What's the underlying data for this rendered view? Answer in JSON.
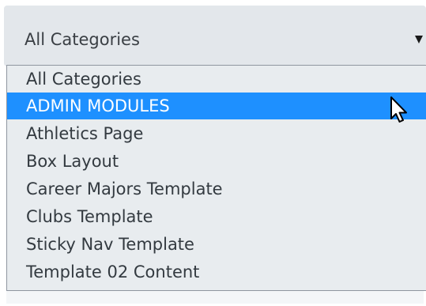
{
  "select": {
    "value": "All Categories",
    "arrow_icon": "triangle-down-icon"
  },
  "dropdown": {
    "options": [
      {
        "label": "All Categories",
        "selected": false
      },
      {
        "label": "ADMIN MODULES",
        "selected": true
      },
      {
        "label": "Athletics Page",
        "selected": false
      },
      {
        "label": "Box Layout",
        "selected": false
      },
      {
        "label": "Career Majors Template",
        "selected": false
      },
      {
        "label": "Clubs Template",
        "selected": false
      },
      {
        "label": "Sticky Nav Template",
        "selected": false
      },
      {
        "label": "Template 02 Content",
        "selected": false
      }
    ]
  },
  "cursor_icon": "mouse-pointer-icon",
  "colors": {
    "selected_bg": "#1e90ff",
    "list_bg": "#e8ecef",
    "select_bg": "#e3e7eb"
  }
}
